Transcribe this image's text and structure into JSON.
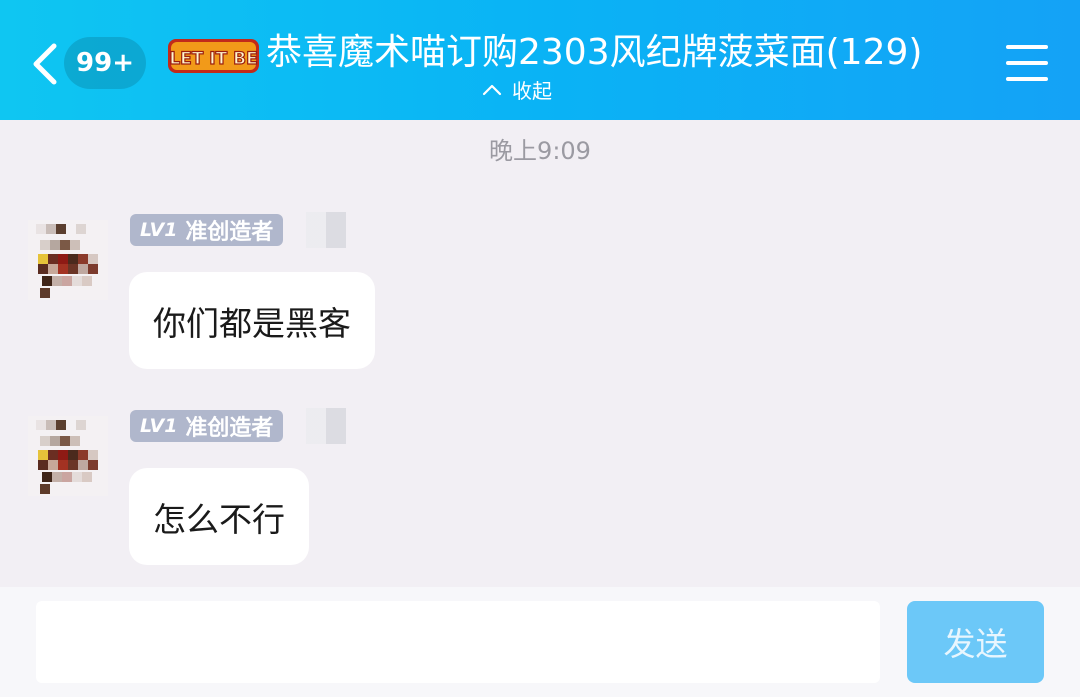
{
  "header": {
    "unread_count": "99+",
    "title": "恭喜魔术喵订购2303风纪牌菠菜面(129)",
    "collapse_label": "收起",
    "group_badge_text": "LET IT BE"
  },
  "chat": {
    "timestamp": "晚上9:09",
    "messages": [
      {
        "level": "LV1",
        "role": "准创造者",
        "text": "你们都是黑客"
      },
      {
        "level": "LV1",
        "role": "准创造者",
        "text": "怎么不行"
      }
    ]
  },
  "composer": {
    "input_value": "",
    "send_label": "发送"
  },
  "colors": {
    "header_start": "#0fc6f2",
    "header_end": "#14a2f6",
    "background": "#f2eff4",
    "badge_bg": "#b0b7cc",
    "send_button": "#6cc8f8"
  }
}
